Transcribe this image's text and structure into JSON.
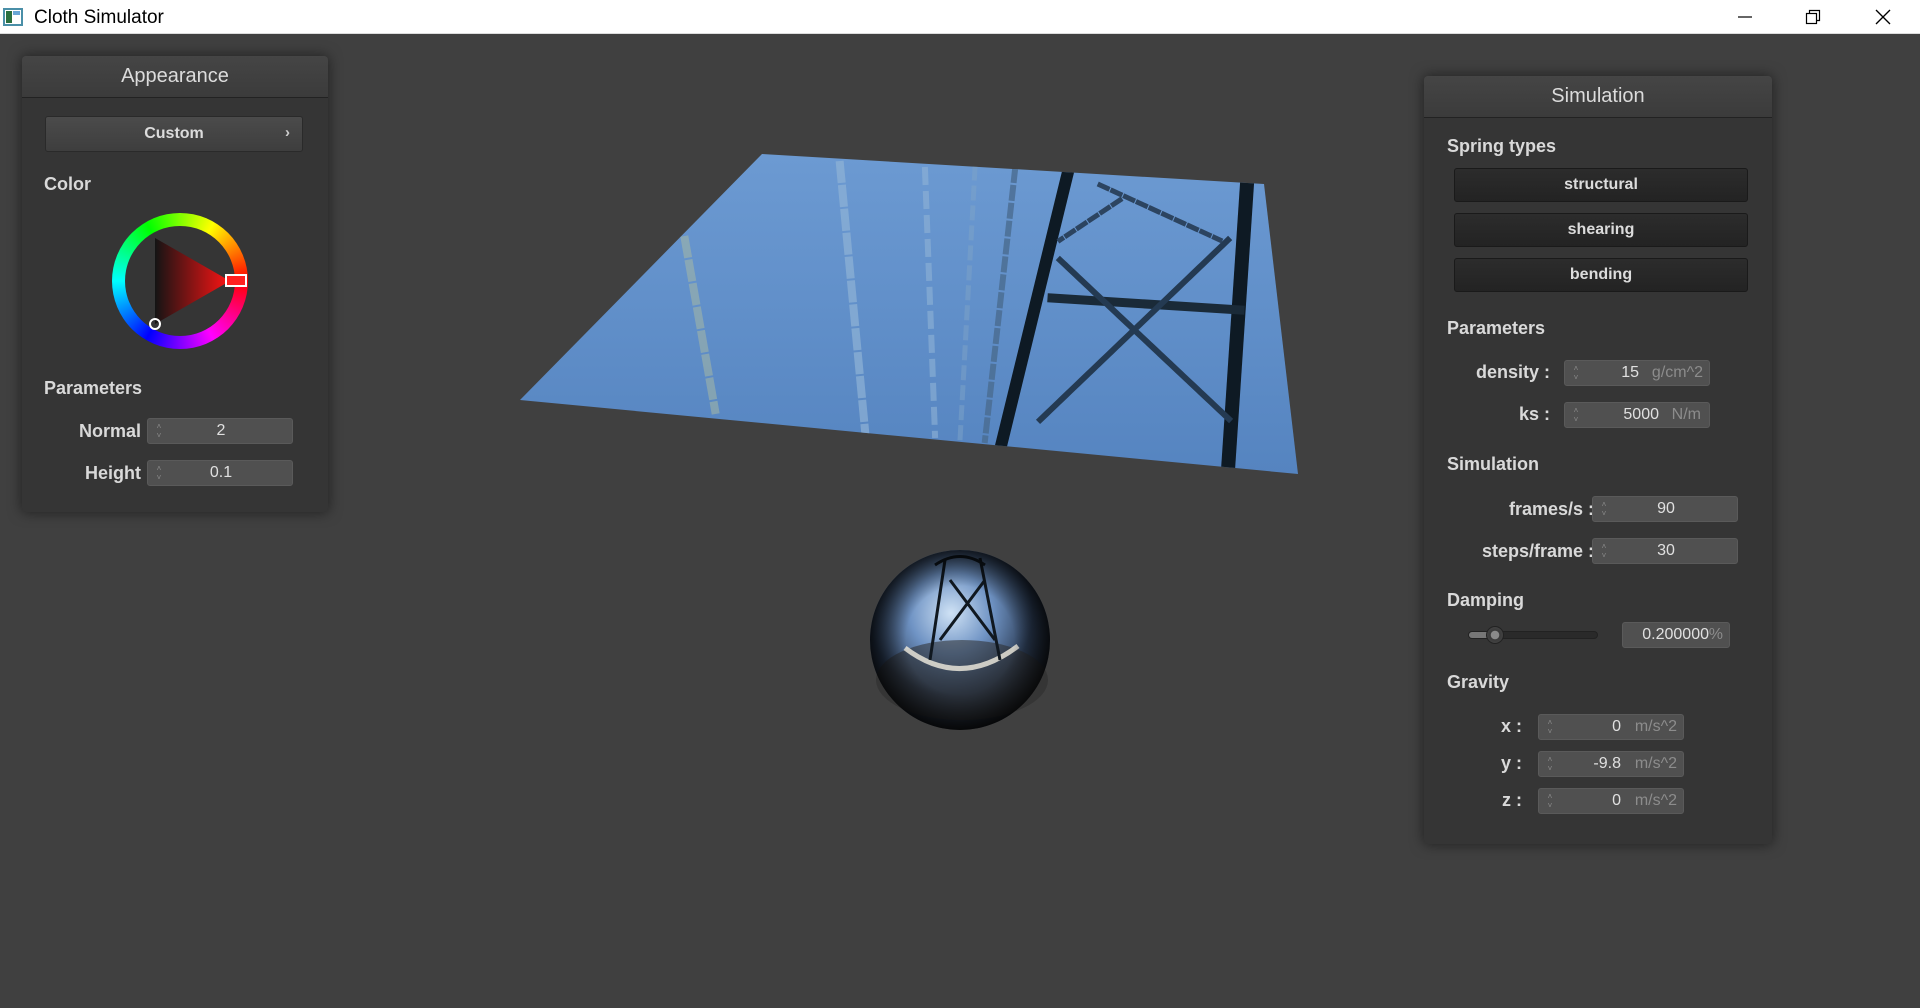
{
  "window": {
    "title": "Cloth Simulator",
    "controls": [
      "minimize-icon",
      "restore-icon",
      "close-icon"
    ]
  },
  "appearance": {
    "title": "Appearance",
    "preset": "Custom",
    "color_label": "Color",
    "selected_color": "#ff0000",
    "parameters_label": "Parameters",
    "normal_label": "Normal :",
    "normal_value": "2",
    "height_label": "Height :",
    "height_value": "0.1"
  },
  "simulation": {
    "title": "Simulation",
    "spring_types_label": "Spring types",
    "spring_types": [
      "structural",
      "shearing",
      "bending"
    ],
    "parameters_label": "Parameters",
    "density_label": "density :",
    "density_value": "15",
    "density_unit": "g/cm^2",
    "ks_label": "ks :",
    "ks_value": "5000",
    "ks_unit": "N/m",
    "simulation_label": "Simulation",
    "fps_label": "frames/s :",
    "fps_value": "90",
    "steps_label": "steps/frame :",
    "steps_value": "30",
    "damping_label": "Damping",
    "damping_value": "0.200000",
    "damping_unit": "%",
    "damping_fraction": 0.2,
    "gravity_label": "Gravity",
    "gx_label": "x :",
    "gx_value": "0",
    "gy_label": "y :",
    "gy_value": "-9.8",
    "gz_label": "z :",
    "gz_value": "0",
    "gravity_unit": "m/s^2"
  },
  "scene": {
    "cloth_color": "#5e8fc9",
    "background_color": "#404040"
  }
}
